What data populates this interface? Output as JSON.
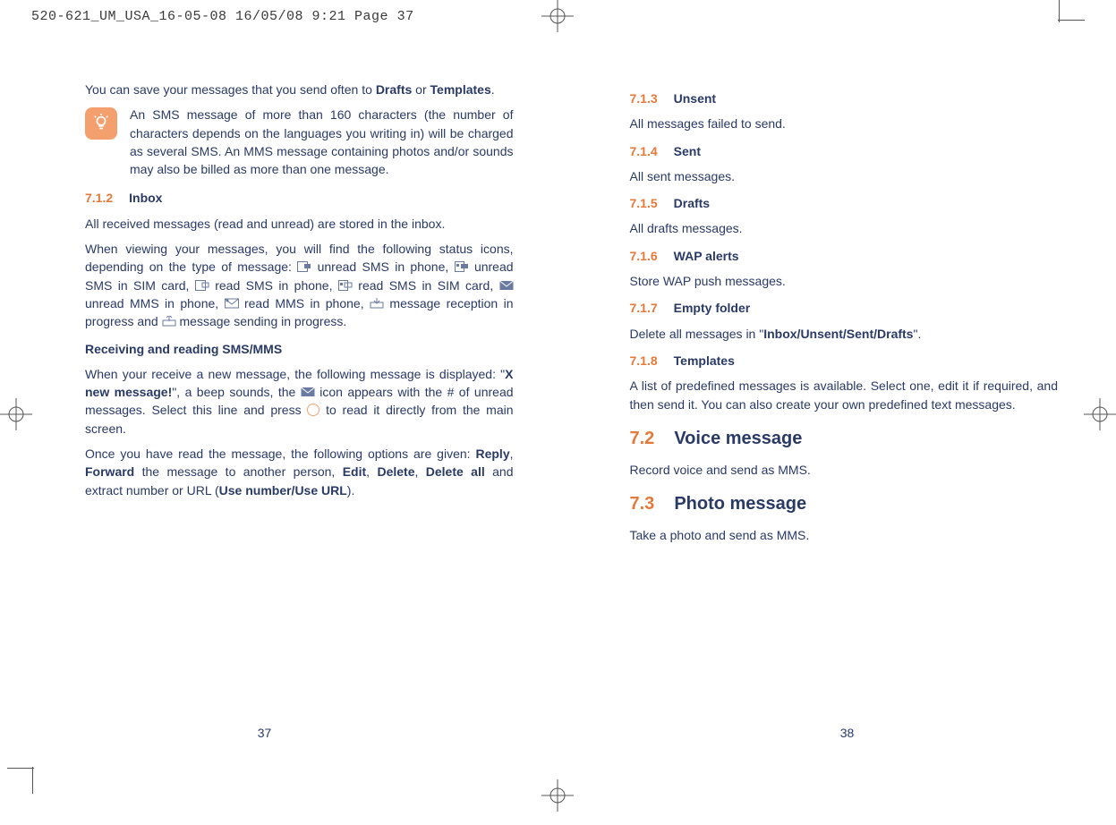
{
  "slug": "520-621_UM_USA_16-05-08  16/05/08  9:21  Page 37",
  "left": {
    "intro": "You can save your messages that you send often to ",
    "intro_b1": "Drafts",
    "intro_mid": " or ",
    "intro_b2": "Templates",
    "intro_end": ".",
    "note": "An SMS message of more than 160 characters (the number of characters depends on the languages you writing in) will be charged as several SMS. An MMS message containing photos and/or sounds may also be billed as more than one message.",
    "s712_num": "7.1.2",
    "s712_title": "Inbox",
    "inbox_p1": "All received messages (read and unread) are stored in the inbox.",
    "icons_p_a": "When viewing your messages, you will find the following status icons, depending on the type of message: ",
    "icons_p_b": " unread SMS in phone, ",
    "icons_p_c": " unread SMS in SIM card, ",
    "icons_p_d": " read SMS in phone, ",
    "icons_p_e": " read SMS in SIM card, ",
    "icons_p_f": " unread MMS in phone, ",
    "icons_p_g": " read MMS in phone, ",
    "icons_p_h": " message reception in progress and ",
    "icons_p_i": " message sending in progress.",
    "recv_h": "Receiving and reading SMS/MMS",
    "recv_p1_a": "When your receive a new message, the following message is displayed: \"",
    "recv_p1_b": "X new message!",
    "recv_p1_c": "\", a beep sounds, the ",
    "recv_p1_d": " icon appears with the # of unread messages. Select this line and press ",
    "recv_p1_e": " to read it directly from the main screen.",
    "recv_p2_a": "Once you have read the message, the following options are given: ",
    "recv_p2_b": "Reply",
    "recv_p2_c": ", ",
    "recv_p2_d": "Forward",
    "recv_p2_e": " the message to another person, ",
    "recv_p2_f": "Edit",
    "recv_p2_g": ", ",
    "recv_p2_h": "Delete",
    "recv_p2_i": ", ",
    "recv_p2_j": "Delete all",
    "recv_p2_k": " and extract number or URL (",
    "recv_p2_l": "Use number/Use URL",
    "recv_p2_m": ").",
    "page_num": "37"
  },
  "right": {
    "s713_num": "7.1.3",
    "s713_title": "Unsent",
    "s713_body": "All messages failed to send.",
    "s714_num": "7.1.4",
    "s714_title": "Sent",
    "s714_body": "All sent messages.",
    "s715_num": "7.1.5",
    "s715_title": "Drafts",
    "s715_body": "All drafts messages.",
    "s716_num": "7.1.6",
    "s716_title": "WAP alerts",
    "s716_body": "Store WAP push messages.",
    "s717_num": "7.1.7",
    "s717_title": "Empty folder",
    "s717_body_a": "Delete all messages in \"",
    "s717_body_b": "Inbox/Unsent/Sent/Drafts",
    "s717_body_c": "\".",
    "s718_num": "7.1.8",
    "s718_title": "Templates",
    "s718_body": "A list of predefined messages is available. Select one, edit it if required, and then send it. You can also create your own predefined text messages.",
    "s72_num": "7.2",
    "s72_title": "Voice message",
    "s72_body": "Record voice and send as MMS.",
    "s73_num": "7.3",
    "s73_title": "Photo message",
    "s73_body": "Take a photo and send as MMS.",
    "page_num": "38"
  }
}
